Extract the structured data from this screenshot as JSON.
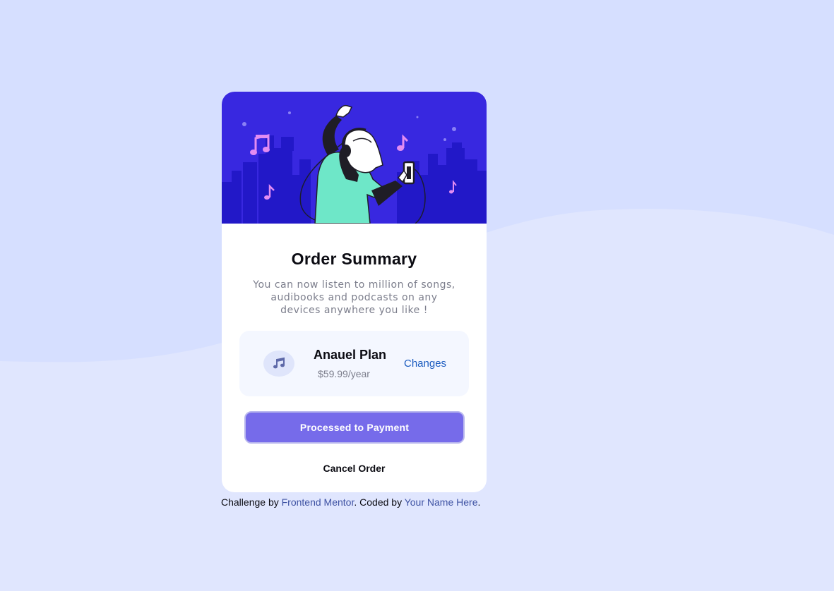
{
  "colors": {
    "page_background": "#e0e6fe",
    "wave_background": "#d6dfff",
    "hero_background": "#3828e0",
    "button_primary": "#766bea",
    "link": "#1a5bbf",
    "attribution_link": "#3e52a3"
  },
  "card": {
    "hero_image": "illustration-hero",
    "title": "Order Summary",
    "description": "You can now listen to million of songs, audibooks and podcasts on any devices anywhere you like !",
    "plan": {
      "icon": "music-note-icon",
      "name": "Anauel Plan",
      "price": "$59.99/year",
      "change_label": "Changes"
    },
    "pay_label": "Processed to Payment",
    "cancel_label": "Cancel Order"
  },
  "attribution": {
    "prefix": "Challenge by",
    "link1": "Frontend Mentor",
    "middle": ". Coded by",
    "link2": "Your Name Here",
    "suffix": "."
  }
}
